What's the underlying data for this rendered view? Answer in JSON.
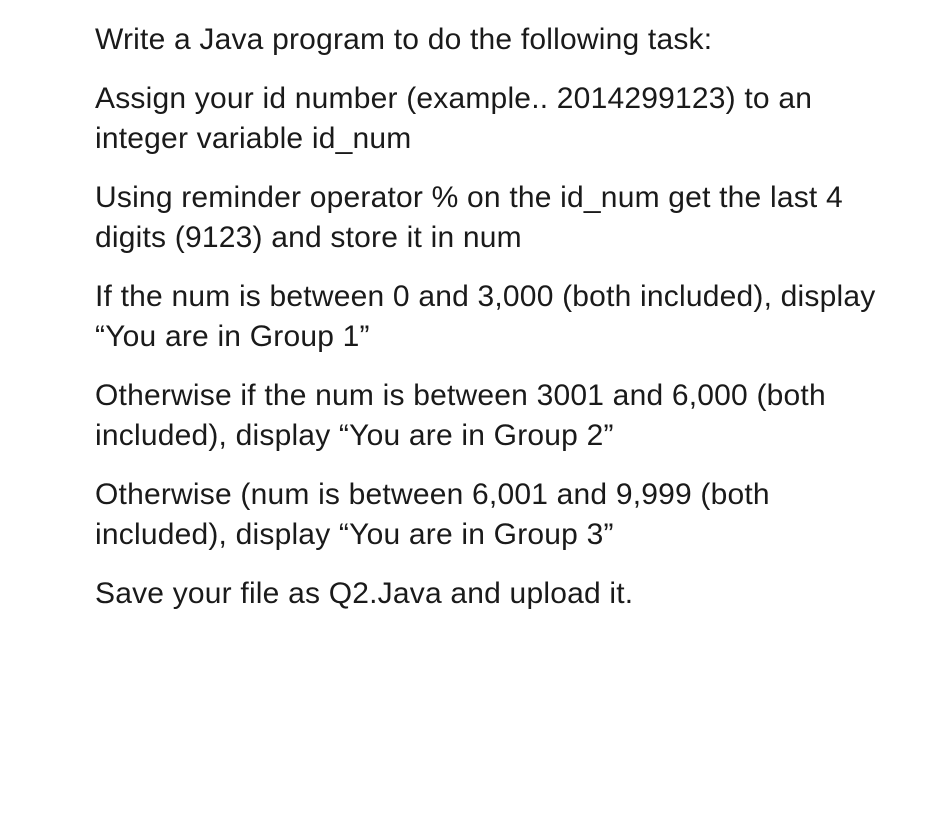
{
  "paragraphs": {
    "p1": "Write a Java program to do the following task:",
    "p2": "Assign your id number (example.. 2014299123) to an integer variable id_num",
    "p3": "Using reminder operator % on the id_num get the last 4 digits (9123) and store it in num",
    "p4": "If the num is between 0 and 3,000 (both included), display “You are in Group 1”",
    "p5": "Otherwise if the num is between 3001 and 6,000 (both included), display “You are in Group 2”",
    "p6": "Otherwise (num is between 6,001 and 9,999 (both included), display “You are in Group 3”",
    "p7": "Save your file as Q2.Java and upload it."
  }
}
